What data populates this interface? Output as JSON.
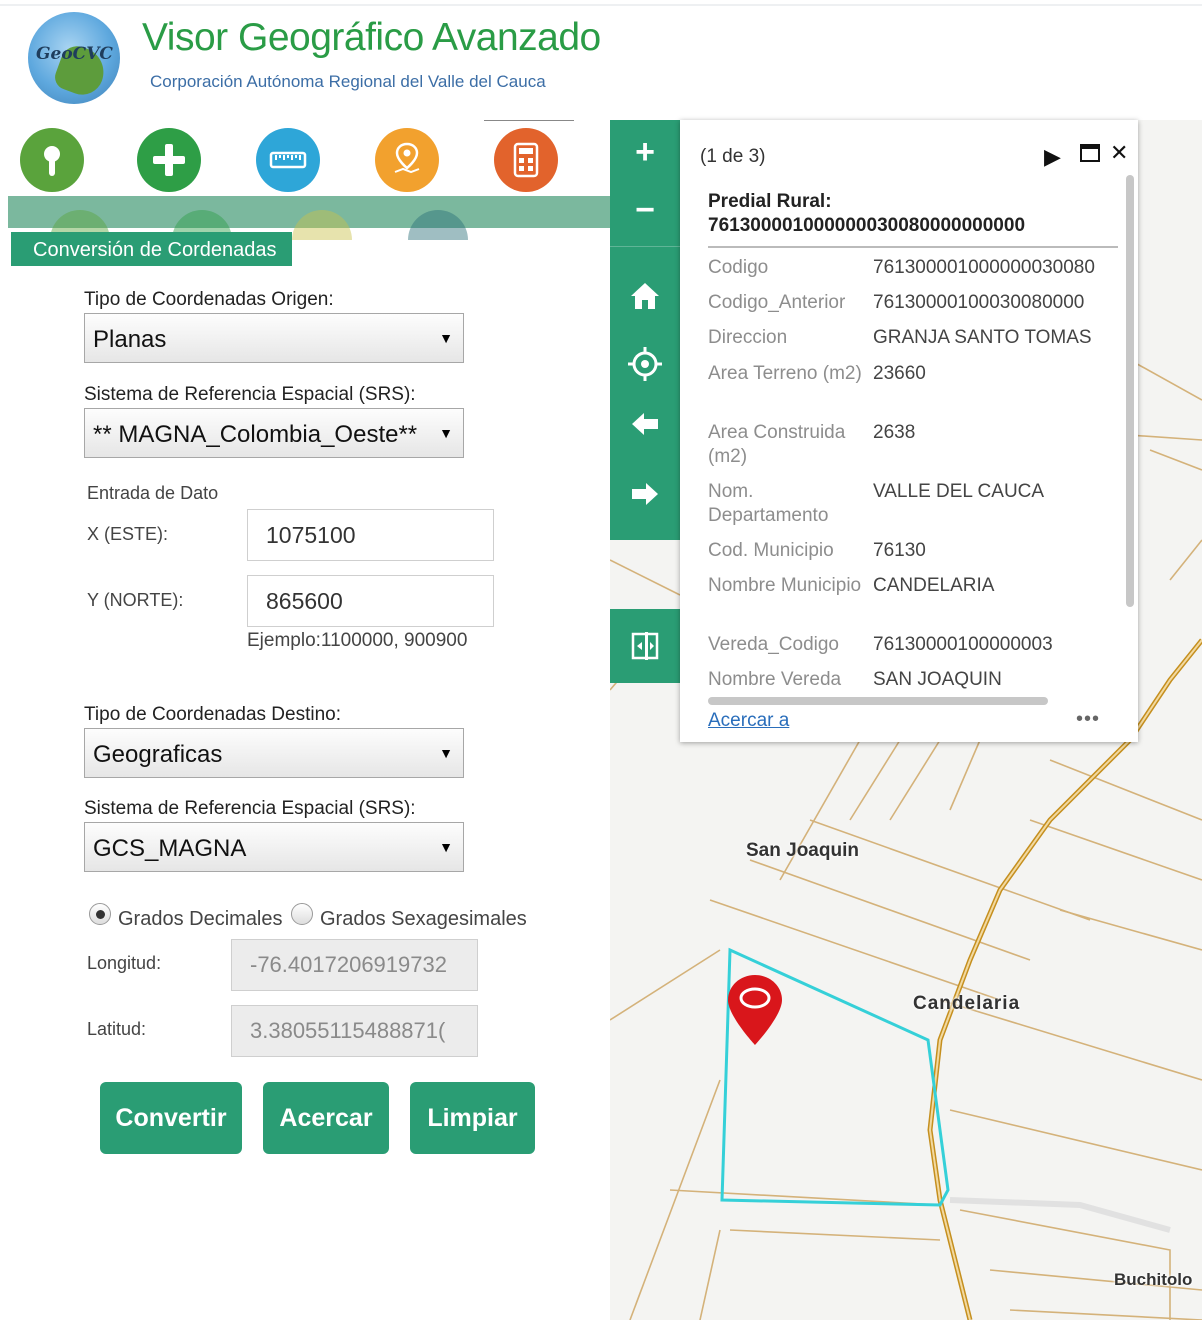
{
  "header": {
    "logo_text": "GeoCVC",
    "title": "Visor Geográfico Avanzado",
    "subtitle": "Corporación Autónoma Regional del Valle del Cauca"
  },
  "toolbar": {
    "tools": [
      {
        "icon": "location-info-icon",
        "color": "#5aa33c"
      },
      {
        "icon": "add-icon",
        "color": "#2e9e46"
      },
      {
        "icon": "measure-icon",
        "color": "#2ea6d8"
      },
      {
        "icon": "map-pin-icon",
        "color": "#f2a12e"
      },
      {
        "icon": "calculator-icon",
        "color": "#e2632c"
      }
    ]
  },
  "panel": {
    "tab_label": "Conversión de Cordenadas",
    "origin_type_label": "Tipo de Coordenadas Origen:",
    "origin_type_value": "Planas",
    "origin_srs_label": "Sistema de Referencia Espacial (SRS):",
    "origin_srs_value": "** MAGNA_Colombia_Oeste**",
    "input_section_label": "Entrada de Dato",
    "x_label": "X (ESTE):",
    "x_value": "1075100",
    "y_label": "Y (NORTE):",
    "y_value": "865600",
    "example_text": "Ejemplo:1100000, 900900",
    "dest_type_label": "Tipo de Coordenadas Destino:",
    "dest_type_value": "Geograficas",
    "dest_srs_label": "Sistema de Referencia Espacial (SRS):",
    "dest_srs_value": "GCS_MAGNA",
    "radio_decimal_label": "Grados Decimales",
    "radio_sexagesimal_label": "Grados Sexagesimales",
    "radio_selected": "decimal",
    "lon_label": "Longitud:",
    "lon_value": "-76.4017206919732",
    "lat_label": "Latitud:",
    "lat_value": "3.38055115488871(",
    "buttons": {
      "convert": "Convertir",
      "zoom": "Acercar",
      "clear": "Limpiar"
    },
    "accent_color": "#2a9d74"
  },
  "map": {
    "nav": {
      "zoom_in": "+",
      "zoom_out": "−"
    },
    "place_labels": {
      "san_joaquin": "San Joaquin",
      "candelaria": "Candelaria",
      "buchitolo": "Buchitolo"
    },
    "parcel_color": "#35d0d8",
    "marker_color": "#d9161b",
    "road_color": "#d8a23a"
  },
  "popup": {
    "count": "(1 de 3)",
    "title_line1": "Predial Rural:",
    "title_line2": "761300001000000030080000000000",
    "attributes": [
      {
        "key": "Codigo",
        "value": "761300001000000030080"
      },
      {
        "key": "Codigo_Anterior",
        "value": "76130000100030080000"
      },
      {
        "key": "Direccion",
        "value": "GRANJA SANTO TOMAS"
      },
      {
        "key": "Area Terreno (m2)",
        "value": "23660"
      },
      {
        "key": "Area Construida (m2)",
        "value": "2638"
      },
      {
        "key": "Nom. Departamento",
        "value": "VALLE DEL CAUCA"
      },
      {
        "key": "Cod. Municipio",
        "value": "76130"
      },
      {
        "key": "Nombre Municipio",
        "value": "CANDELARIA"
      },
      {
        "key": "Vereda_Codigo",
        "value": "76130000100000003"
      },
      {
        "key": "Nombre Vereda",
        "value": "SAN JOAQUIN"
      }
    ],
    "zoom_link": "Acercar a",
    "more": "•••"
  }
}
